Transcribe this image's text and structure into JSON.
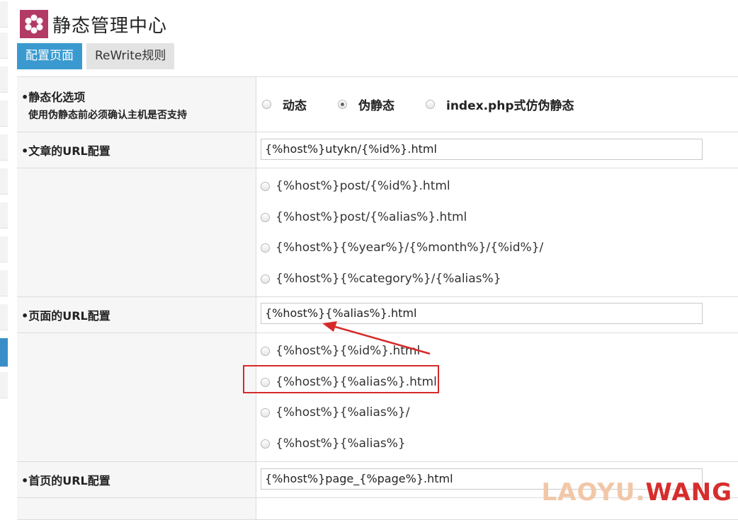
{
  "header": {
    "title": "静态管理中心",
    "logo_icon": "flower-icon",
    "logo_color": "#b23a64"
  },
  "tabs": [
    {
      "label": "配置页面",
      "active": true
    },
    {
      "label": "ReWrite规则",
      "active": false
    }
  ],
  "static_options": {
    "label": "•静态化选项",
    "sublabel": "使用伪静态前必须确认主机是否支持",
    "modes": [
      {
        "label": "动态",
        "checked": false
      },
      {
        "label": "伪静态",
        "checked": true
      },
      {
        "label": "index.php式仿伪静态",
        "checked": false
      }
    ]
  },
  "article_url": {
    "label": "•文章的URL配置",
    "value": "{%host%}utykn/{%id%}.html",
    "options": [
      "{%host%}post/{%id%}.html",
      "{%host%}post/{%alias%}.html",
      "{%host%}{%year%}/{%month%}/{%id%}/",
      "{%host%}{%category%}/{%alias%}"
    ]
  },
  "page_url": {
    "label": "•页面的URL配置",
    "value": "{%host%}{%alias%}.html",
    "options": [
      "{%host%}{%id%}.html",
      "{%host%}{%alias%}.html",
      "{%host%}{%alias%}/",
      "{%host%}{%alias%}"
    ]
  },
  "home_url": {
    "label": "•首页的URL配置",
    "value": "{%host%}page_{%page%}.html"
  },
  "annotation": {
    "color": "#d62a2a"
  },
  "watermark": {
    "part1": "LAOYU.",
    "part2": "WANG"
  }
}
